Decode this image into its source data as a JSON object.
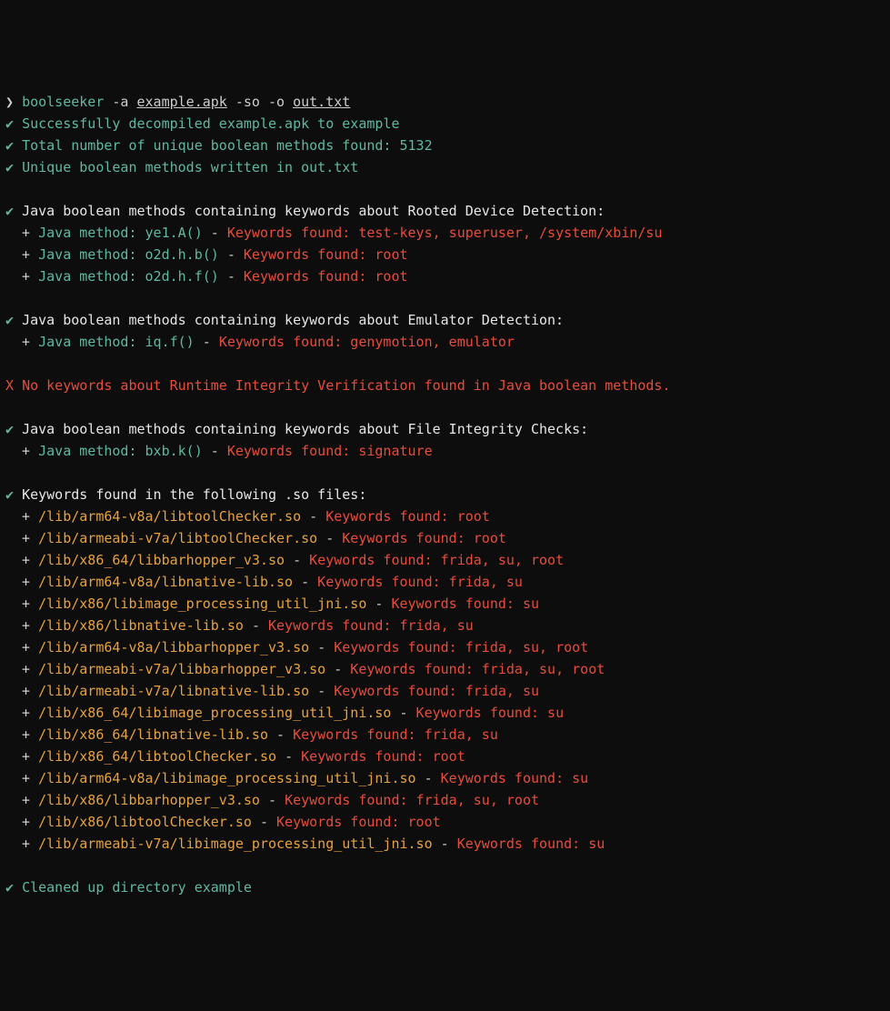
{
  "prompt": "❯",
  "command": {
    "bin": "boolseeker",
    "pre_apk": " -a ",
    "apk": "example.apk",
    "mid": " -so -o ",
    "out": "out.txt"
  },
  "status": [
    "Successfully decompiled example.apk to example",
    "Total number of unique boolean methods found: 5132",
    "Unique boolean methods written in out.txt"
  ],
  "checkmark": "✔",
  "plus": "+",
  "dash": "-",
  "xmark": "X",
  "sections": [
    {
      "title": "Java boolean methods containing keywords about Rooted Device Detection:",
      "items": [
        {
          "label": "Java method:",
          "value": "ye1.A()",
          "kw": "Keywords found: test-keys, superuser, /system/xbin/su"
        },
        {
          "label": "Java method:",
          "value": "o2d.h.b()",
          "kw": "Keywords found: root"
        },
        {
          "label": "Java method:",
          "value": "o2d.h.f()",
          "kw": "Keywords found: root"
        }
      ]
    },
    {
      "title": "Java boolean methods containing keywords about Emulator Detection:",
      "items": [
        {
          "label": "Java method:",
          "value": "iq.f()",
          "kw": "Keywords found: genymotion, emulator"
        }
      ]
    }
  ],
  "error_line": "No keywords about Runtime Integrity Verification found in Java boolean methods.",
  "section_fic": {
    "title": "Java boolean methods containing keywords about File Integrity Checks:",
    "items": [
      {
        "label": "Java method:",
        "value": "bxb.k()",
        "kw": "Keywords found: signature"
      }
    ]
  },
  "so_section": {
    "title": "Keywords found in the following .so files:",
    "items": [
      {
        "path": "/lib/arm64-v8a/libtoolChecker.so",
        "kw": "Keywords found: root"
      },
      {
        "path": "/lib/armeabi-v7a/libtoolChecker.so",
        "kw": "Keywords found: root"
      },
      {
        "path": "/lib/x86_64/libbarhopper_v3.so",
        "kw": "Keywords found: frida, su, root"
      },
      {
        "path": "/lib/arm64-v8a/libnative-lib.so",
        "kw": "Keywords found: frida, su"
      },
      {
        "path": "/lib/x86/libimage_processing_util_jni.so",
        "kw": "Keywords found: su"
      },
      {
        "path": "/lib/x86/libnative-lib.so",
        "kw": "Keywords found: frida, su"
      },
      {
        "path": "/lib/arm64-v8a/libbarhopper_v3.so",
        "kw": "Keywords found: frida, su, root"
      },
      {
        "path": "/lib/armeabi-v7a/libbarhopper_v3.so",
        "kw": "Keywords found: frida, su, root"
      },
      {
        "path": "/lib/armeabi-v7a/libnative-lib.so",
        "kw": "Keywords found: frida, su"
      },
      {
        "path": "/lib/x86_64/libimage_processing_util_jni.so",
        "kw": "Keywords found: su"
      },
      {
        "path": "/lib/x86_64/libnative-lib.so",
        "kw": "Keywords found: frida, su"
      },
      {
        "path": "/lib/x86_64/libtoolChecker.so",
        "kw": "Keywords found: root"
      },
      {
        "path": "/lib/arm64-v8a/libimage_processing_util_jni.so",
        "kw": "Keywords found: su"
      },
      {
        "path": "/lib/x86/libbarhopper_v3.so",
        "kw": "Keywords found: frida, su, root"
      },
      {
        "path": "/lib/x86/libtoolChecker.so",
        "kw": "Keywords found: root"
      },
      {
        "path": "/lib/armeabi-v7a/libimage_processing_util_jni.so",
        "kw": "Keywords found: su"
      }
    ]
  },
  "cleanup": "Cleaned up directory example"
}
